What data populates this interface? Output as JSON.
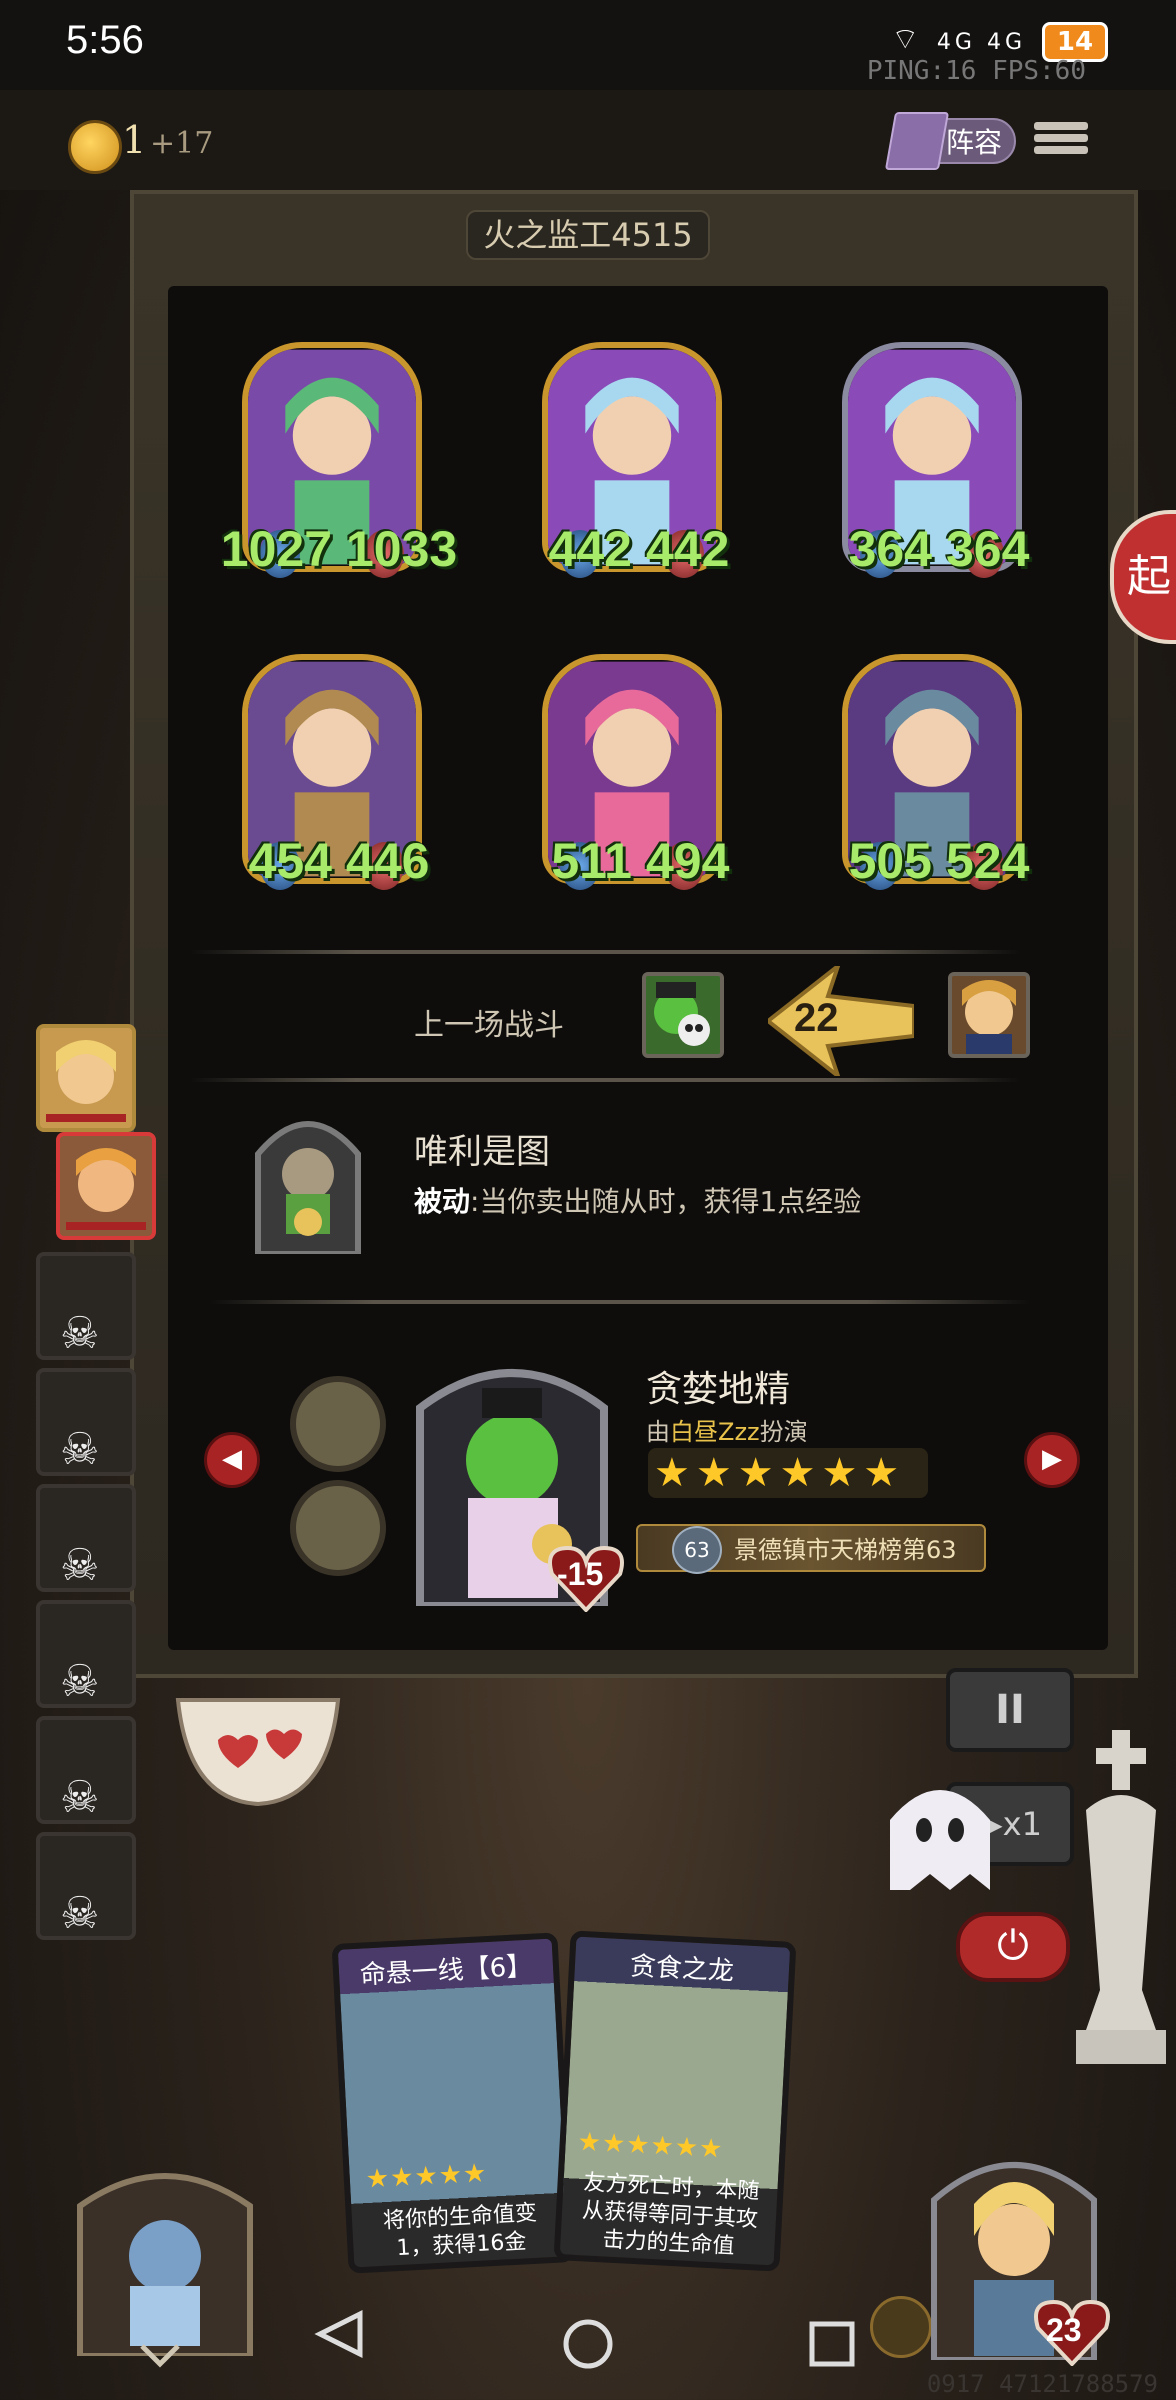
{
  "status_bar": {
    "time": "5:56",
    "signal": "4G 4G",
    "battery": "14",
    "net_info": "PING:16   FPS:60"
  },
  "top_bar": {
    "coins": "1",
    "coins_income": "+17",
    "lineup_label": "阵容"
  },
  "opponent": {
    "name_tag": "火之监工4515"
  },
  "minions": [
    {
      "atk": "1027",
      "hp": "1033",
      "frame": "gold",
      "icon": "fairy-portrait"
    },
    {
      "atk": "442",
      "hp": "442",
      "frame": "gold",
      "icon": "siren-portrait"
    },
    {
      "atk": "364",
      "hp": "364",
      "frame": "silver",
      "icon": "siren-portrait"
    },
    {
      "atk": "454",
      "hp": "446",
      "frame": "gold",
      "icon": "scarecrow-portrait"
    },
    {
      "atk": "511",
      "hp": "494",
      "frame": "gold",
      "icon": "rose-lady-portrait"
    },
    {
      "atk": "505",
      "hp": "524",
      "frame": "gold",
      "icon": "spider-portrait"
    }
  ],
  "last_battle": {
    "label": "上一场战斗",
    "damage": "22"
  },
  "hero_power": {
    "name": "唯利是图",
    "prefix": "被动",
    "desc": ":当你卖出随从时，获得1点经验"
  },
  "opponent_hero": {
    "name": "贪婪地精",
    "played_by_prefix": "由",
    "played_by_name": "白昼Zzz",
    "played_by_suffix": "扮演",
    "stars": 6,
    "rank_num": "63",
    "rank_text": "景德镇市天梯榜第63",
    "damage_taken": "-15"
  },
  "controls": {
    "start_label": "起",
    "pause": "II",
    "speed": "▶x1"
  },
  "cards": [
    {
      "title": "命悬一线【6】",
      "stars": "★★★★★",
      "desc": "将你的生命值变 1，获得16金"
    },
    {
      "title": "贪食之龙",
      "stars": "★★★★★★",
      "desc": "友方死亡时，本随从获得等同于其攻击力的生命值"
    }
  ],
  "player": {
    "hp": "23"
  },
  "watermark": "0917 47121788579",
  "colors": {
    "stat_green": "#a8ea6a",
    "gold_frame": "#c8962c",
    "accent_red": "#c03030",
    "star_gold": "#ffc829"
  }
}
